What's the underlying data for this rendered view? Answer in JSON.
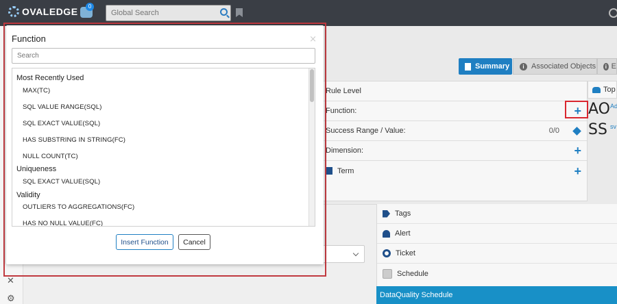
{
  "header": {
    "logo_text": "OVALEDGE",
    "notification_count": "0",
    "search_placeholder": "Global Search"
  },
  "tabs": [
    {
      "label": "Summary",
      "active": true
    },
    {
      "label": "Associated Objects",
      "active": false
    },
    {
      "label": "E",
      "active": false
    }
  ],
  "rule_panel": {
    "rows": [
      {
        "label": "Rule Level",
        "value": ""
      },
      {
        "label": "Function:",
        "value": ""
      },
      {
        "label": "Success Range / Value:",
        "value": "0/0"
      },
      {
        "label": "Dimension:",
        "value": ""
      },
      {
        "label": "Term",
        "value": ""
      }
    ]
  },
  "top_users": {
    "header": "Top",
    "users": [
      {
        "initials": "AO",
        "name": "Ad"
      },
      {
        "initials": "SS",
        "name": "sv"
      }
    ]
  },
  "right_lower": {
    "items": [
      "Tags",
      "Alert",
      "Ticket",
      "Schedule"
    ],
    "schedule_bar": "DataQuality Schedule"
  },
  "modal": {
    "title": "Function",
    "close": "×",
    "search_placeholder": "Search",
    "groups": [
      {
        "name": "Most Recently Used",
        "items": [
          "MAX(TC)",
          "SQL VALUE RANGE(SQL)",
          "SQL EXACT VALUE(SQL)",
          "HAS SUBSTRING IN STRING(FC)",
          "NULL COUNT(TC)"
        ]
      },
      {
        "name": "Uniqueness",
        "items": [
          "SQL EXACT VALUE(SQL)"
        ]
      },
      {
        "name": "Validity",
        "items": [
          "OUTLIERS TO AGGREGATIONS(FC)",
          "HAS NO NULL VALUE(FC)"
        ]
      }
    ],
    "insert_label": "Insert Function",
    "cancel_label": "Cancel"
  },
  "colors": {
    "topbar": "#3a3e45",
    "accent": "#1f7fc2",
    "highlight": "#d9262e",
    "schedule_bar": "#1890c7"
  }
}
